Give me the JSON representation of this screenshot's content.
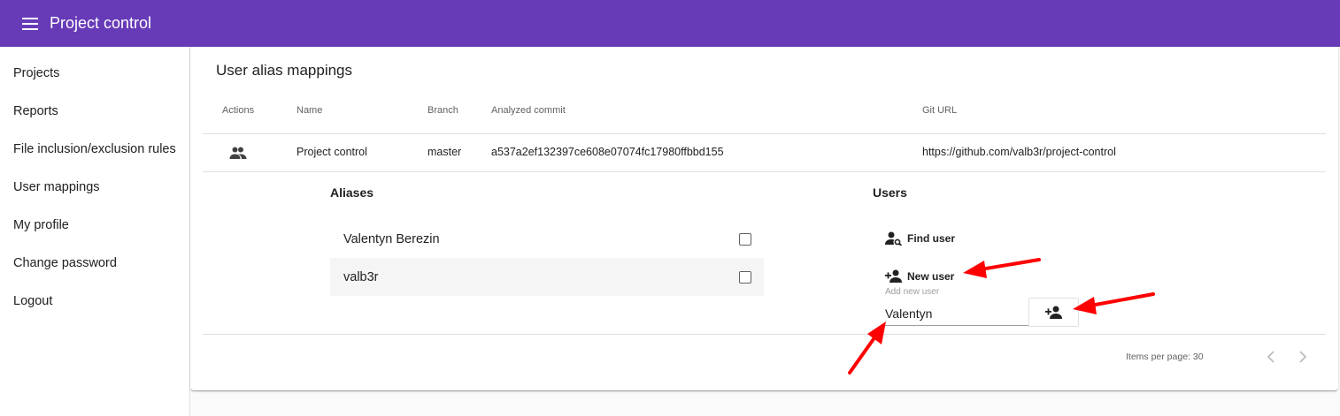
{
  "app": {
    "title": "Project control"
  },
  "sidebar": {
    "items": [
      {
        "label": "Projects"
      },
      {
        "label": "Reports"
      },
      {
        "label": "File inclusion/exclusion rules"
      },
      {
        "label": "User mappings"
      },
      {
        "label": "My profile"
      },
      {
        "label": "Change password"
      },
      {
        "label": "Logout"
      }
    ]
  },
  "main": {
    "title": "User alias mappings",
    "table": {
      "columns": [
        "Actions",
        "Name",
        "Branch",
        "Analyzed commit",
        "Git URL"
      ],
      "rows": [
        {
          "action_icon": "people-icon",
          "name": "Project control",
          "branch": "master",
          "commit": "a537a2ef132397ce608e07074fc17980ffbbd155",
          "git_url": "https://github.com/valb3r/project-control"
        }
      ]
    },
    "aliases": {
      "title": "Aliases",
      "items": [
        {
          "label": "Valentyn Berezin",
          "checked": false
        },
        {
          "label": "valb3r",
          "checked": false
        }
      ]
    },
    "users": {
      "title": "Users",
      "find_user_label": "Find user",
      "new_user_label": "New user",
      "new_user_field_label": "Add new user",
      "new_user_value": "Valentyn"
    },
    "paginator": {
      "items_per_page_label": "Items per page: 30"
    }
  },
  "colors": {
    "toolbar": "#673ab7",
    "annotation_arrow": "#ff0000"
  }
}
